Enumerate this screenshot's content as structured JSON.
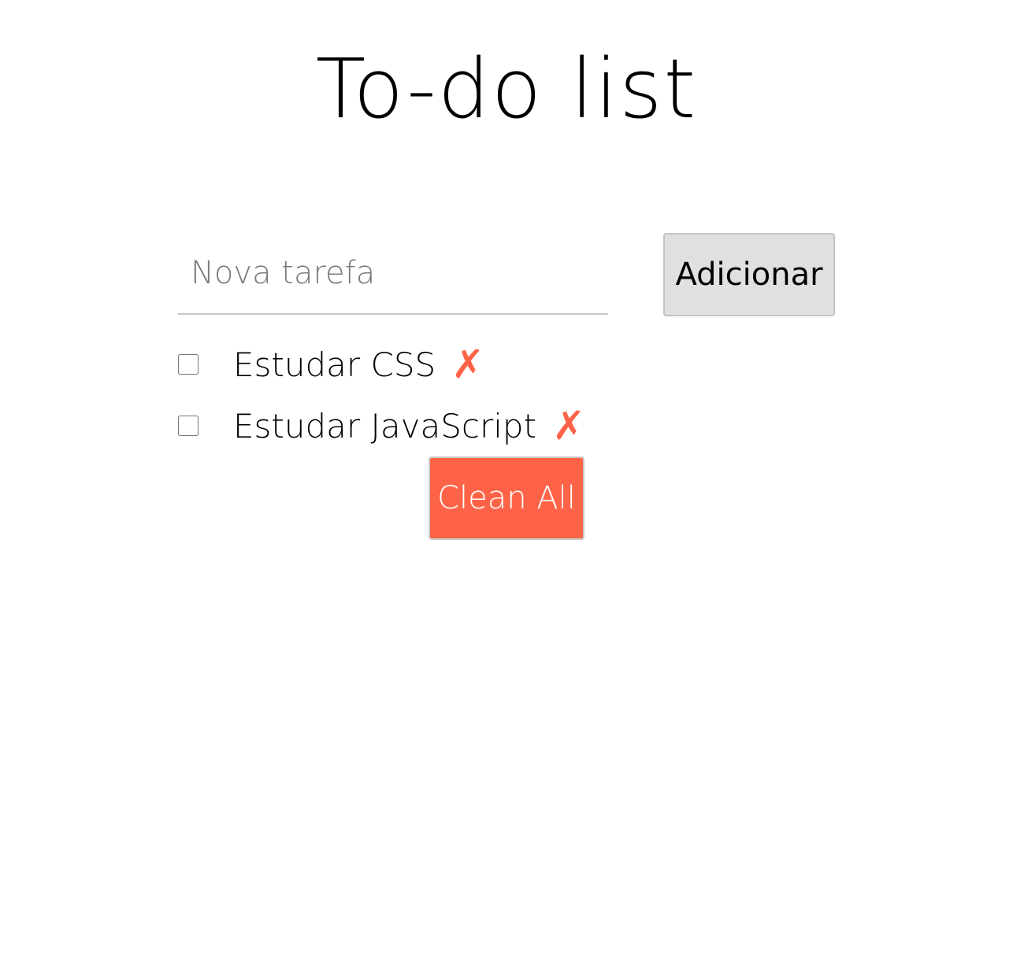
{
  "header": {
    "title": "To-do list"
  },
  "form": {
    "input_value": "",
    "input_placeholder": "Nova tarefa",
    "add_label": "Adicionar"
  },
  "tasks": [
    {
      "label": "Estudar CSS",
      "checked": false,
      "delete_glyph": "✗"
    },
    {
      "label": "Estudar JavaScript",
      "checked": false,
      "delete_glyph": "✗"
    }
  ],
  "actions": {
    "clean_label": "Clean All"
  },
  "colors": {
    "accent": "#ff6347",
    "button_gray": "#e0e0e0",
    "text": "#000000",
    "placeholder": "#7a7a7a"
  },
  "icons": {
    "delete": "close-x-icon"
  }
}
